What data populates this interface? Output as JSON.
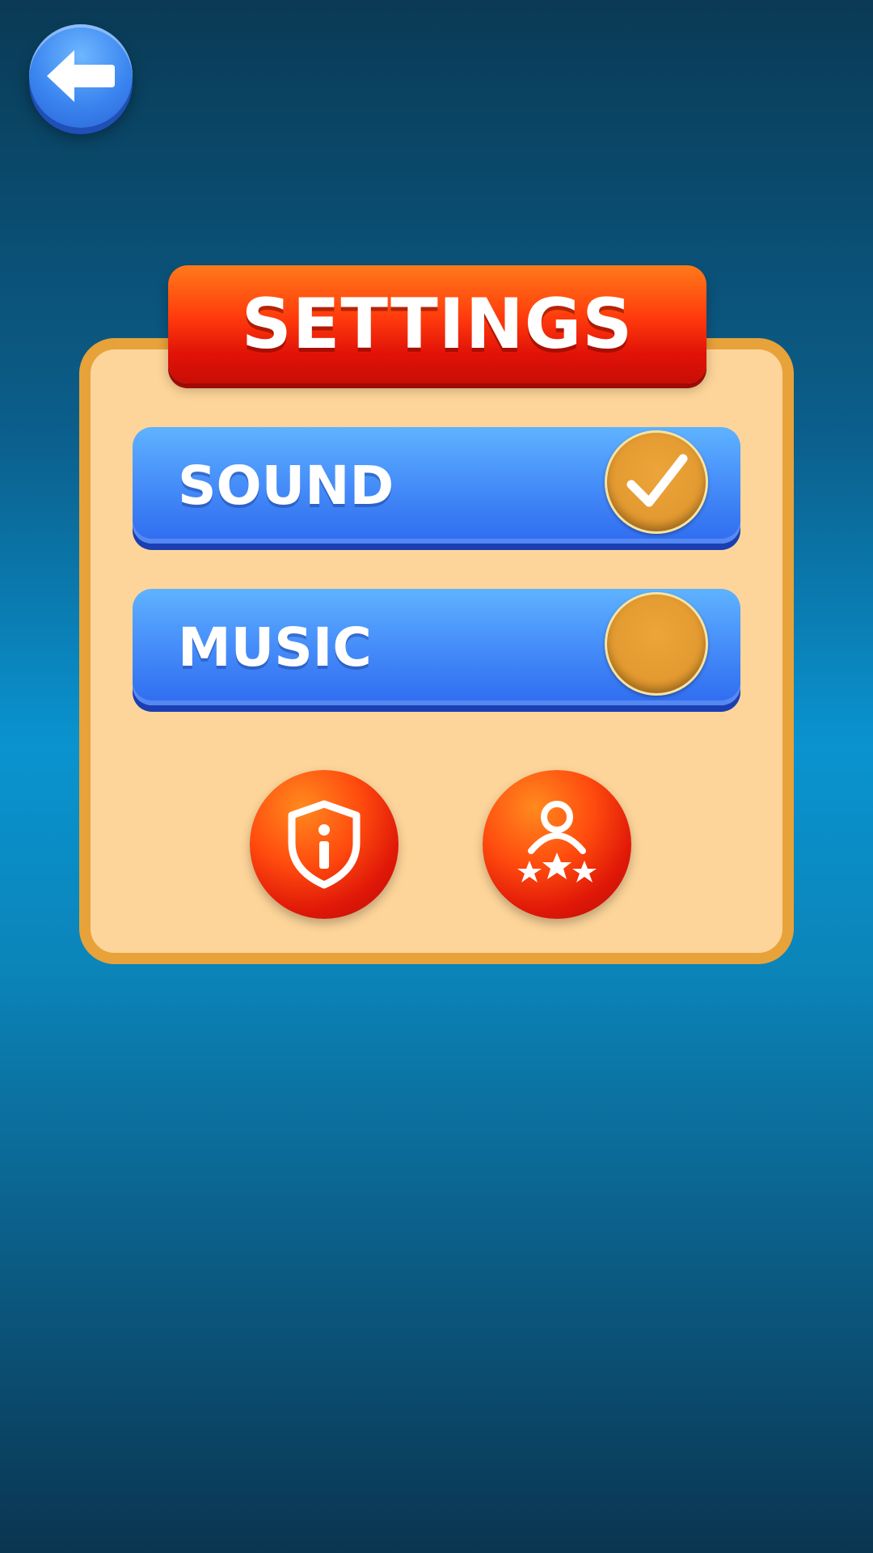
{
  "header": {
    "back_icon": "arrow-left-icon"
  },
  "panel": {
    "title": "SETTINGS",
    "options": [
      {
        "label": "SOUND",
        "enabled": true,
        "icon": "checkmark-icon"
      },
      {
        "label": "MUSIC",
        "enabled": false,
        "icon": ""
      }
    ],
    "buttons": [
      {
        "icon": "shield-info-icon"
      },
      {
        "icon": "user-rating-stars-icon"
      }
    ]
  },
  "colors": {
    "background": "#0a93cf",
    "panel_fill": "#fdd59a",
    "panel_border": "#e8a23a",
    "title_red": "#e11208",
    "row_blue": "#3a7cf4",
    "toggle_orange": "#e39a30"
  }
}
